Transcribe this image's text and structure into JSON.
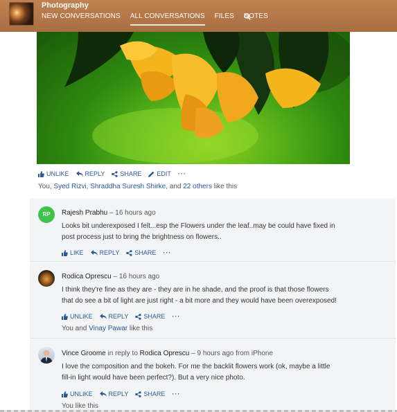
{
  "header": {
    "group_title": "Photography",
    "nav": [
      "NEW CONVERSATIONS",
      "ALL CONVERSATIONS",
      "FILES",
      "NOTES"
    ],
    "active_nav": "ALL CONVERSATIONS",
    "search_icon": "search-icon"
  },
  "post": {
    "actions": {
      "unlike": "UNLIKE",
      "reply": "REPLY",
      "share": "SHARE",
      "edit": "EDIT",
      "more": "···"
    },
    "likes": {
      "prefix": "You, ",
      "user1": "Syed Rizvi",
      "sep1": ", ",
      "user2": "Shraddha Suresh Shirke",
      "mid": ", and ",
      "others": "22 others",
      "suffix": " like this"
    }
  },
  "comments": [
    {
      "initials": "RP",
      "author": "Rajesh Prabhu",
      "meta": " – 16 hours ago",
      "lines": [
        "Looks bit underexposed I felt...esp the Flowers under the leaf..may be could have fixed in",
        "post process just to bring the brightness on flowers.."
      ],
      "actions": {
        "like": "LIKE",
        "reply": "REPLY",
        "share": "SHARE",
        "more": "···"
      }
    },
    {
      "author": "Rodica Oprescu",
      "meta": " – 16 hours ago",
      "lines": [
        "I think they're fine as they are - they are in he shade, and the proof is that those flowers",
        "that do see a bit of light are just right - a bit more and they would have been overexposed!"
      ],
      "actions": {
        "like": "UNLIKE",
        "reply": "REPLY",
        "share": "SHARE",
        "more": "···"
      },
      "likes": {
        "prefix": "You and ",
        "user": "Vinay Pawar",
        "suffix": " like this"
      }
    },
    {
      "author": "Vince Groome",
      "reply_text": " in reply to ",
      "reply_to": "Rodica Oprescu",
      "meta": " – 9 hours ago from iPhone",
      "lines": [
        "I love the composition and the bokeh. For me the backlit flowers work (ok, maybe a little",
        "fill-in light would have been perfect?). But a very nice photo."
      ],
      "actions": {
        "like": "UNLIKE",
        "reply": "REPLY",
        "share": "SHARE",
        "more": "···"
      },
      "likes_text": "You like this"
    }
  ],
  "colors": {
    "header": "#b87a4a",
    "link": "#2b5797",
    "comment_bg": "#f3f4f6",
    "rp_avatar": "#3ec44b"
  }
}
